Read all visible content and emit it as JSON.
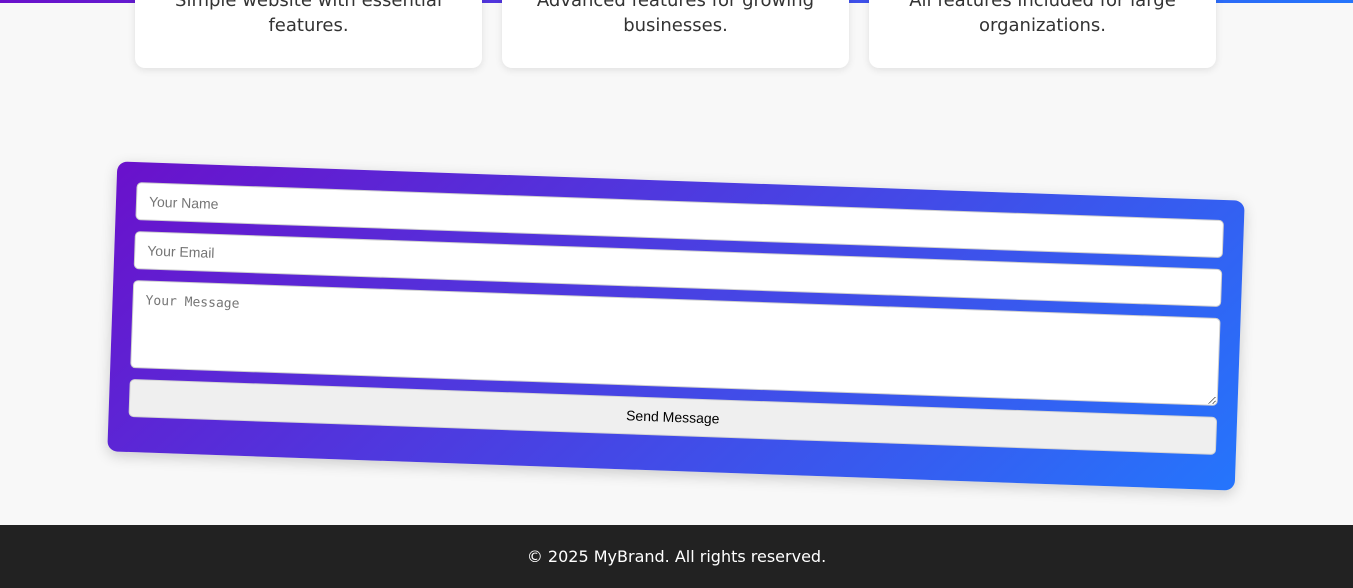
{
  "cards": [
    {
      "description": "Simple website with essential features."
    },
    {
      "description": "Advanced features for growing businesses."
    },
    {
      "description": "All features included for large organizations."
    }
  ],
  "contact_form": {
    "name_placeholder": "Your Name",
    "email_placeholder": "Your Email",
    "message_placeholder": "Your Message",
    "submit_label": "Send Message",
    "gradient_start": "#6a11cb",
    "gradient_end": "#2575fc"
  },
  "footer": {
    "text": "© 2025 MyBrand. All rights reserved."
  }
}
